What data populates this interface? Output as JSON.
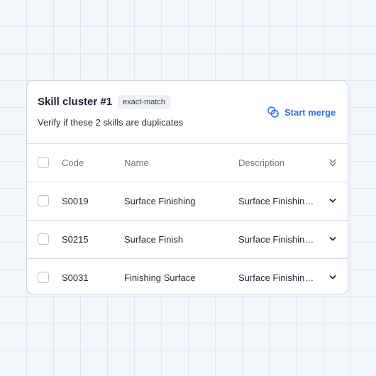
{
  "card": {
    "title": "Skill cluster #1",
    "badge": "exact-match",
    "subtitle": "Verify if these 2 skills are duplicates",
    "merge_label": "Start merge",
    "accent_color": "#2f6fe4"
  },
  "table": {
    "headers": {
      "code": "Code",
      "name": "Name",
      "description": "Description"
    },
    "rows": [
      {
        "code": "S0019",
        "name": "Surface Finishing",
        "description": "Surface Finishing..."
      },
      {
        "code": "S0215",
        "name": "Surface Finish",
        "description": "Surface Finishing..."
      },
      {
        "code": "S0031",
        "name": "Finishing Surface",
        "description": "Surface Finishing..."
      }
    ]
  },
  "icons": {
    "merge": "overlapping-circles-icon",
    "expand_all": "double-chevron-down-icon",
    "row_expand": "chevron-down-icon"
  }
}
